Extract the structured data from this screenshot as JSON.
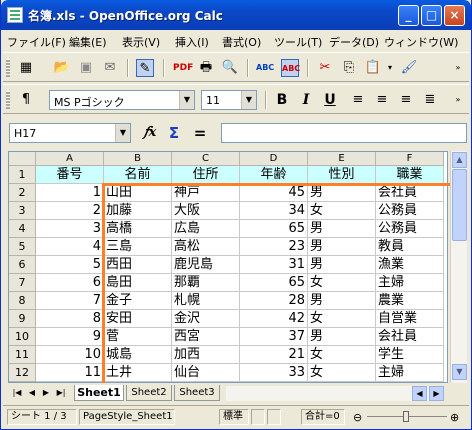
{
  "window": {
    "title": "名簿.xls - OpenOffice.org Calc",
    "min_label": "_",
    "max_label": "□",
    "close_label": "×"
  },
  "menu": [
    "ファイル(F)",
    "編集(E)",
    "表示(V)",
    "挿入(I)",
    "書式(O)",
    "ツール(T)",
    "データ(D)",
    "ウィンドウ(W)"
  ],
  "toolbar1": {
    "icons": [
      "new-icon",
      "open-icon",
      "save-icon",
      "mail-icon",
      "edit-file-icon",
      "pdf-icon",
      "print-icon",
      "preview-icon",
      "spellcheck-icon",
      "autospell-icon",
      "cut-icon",
      "copy-icon",
      "paste-icon",
      "format-paintbrush-icon"
    ]
  },
  "toolbar2": {
    "font_name": "MS Pゴシック",
    "font_size": "11",
    "bold_label": "B",
    "italic_label": "I",
    "underline_label": "U"
  },
  "formula_bar": {
    "name_box": "H17",
    "fx_label": "𝑓x",
    "sum_label": "Σ",
    "equals_label": "=",
    "input_value": ""
  },
  "sheet": {
    "columns": [
      "A",
      "B",
      "C",
      "D",
      "E",
      "F"
    ],
    "rows": [
      [
        "番号",
        "名前",
        "住所",
        "年齢",
        "性別",
        "職業"
      ],
      [
        "1",
        "山田",
        "神戸",
        "45",
        "男",
        "会社員"
      ],
      [
        "2",
        "加藤",
        "大阪",
        "34",
        "女",
        "公務員"
      ],
      [
        "3",
        "高橋",
        "広島",
        "65",
        "男",
        "公務員"
      ],
      [
        "4",
        "三島",
        "高松",
        "23",
        "男",
        "教員"
      ],
      [
        "5",
        "西田",
        "鹿児島",
        "31",
        "男",
        "漁業"
      ],
      [
        "6",
        "島田",
        "那覇",
        "65",
        "女",
        "主婦"
      ],
      [
        "7",
        "金子",
        "札幌",
        "28",
        "男",
        "農業"
      ],
      [
        "8",
        "安田",
        "金沢",
        "42",
        "女",
        "自営業"
      ],
      [
        "9",
        "菅",
        "西宮",
        "37",
        "男",
        "会社員"
      ],
      [
        "10",
        "城島",
        "加西",
        "21",
        "女",
        "学生"
      ],
      [
        "11",
        "土井",
        "仙台",
        "33",
        "女",
        "主婦"
      ]
    ],
    "row_numbers": [
      "1",
      "2",
      "3",
      "4",
      "5",
      "6",
      "7",
      "8",
      "9",
      "10",
      "11",
      "12"
    ]
  },
  "tabs": [
    "Sheet1",
    "Sheet2",
    "Sheet3"
  ],
  "active_tab": "Sheet1",
  "status": {
    "sheet": "シート 1 / 3",
    "page_style": "PageStyle_Sheet1",
    "mode": "標準",
    "sum": "合計=0"
  },
  "colors": {
    "header_fill": "#ccffff",
    "highlight": "#ff7f27"
  }
}
